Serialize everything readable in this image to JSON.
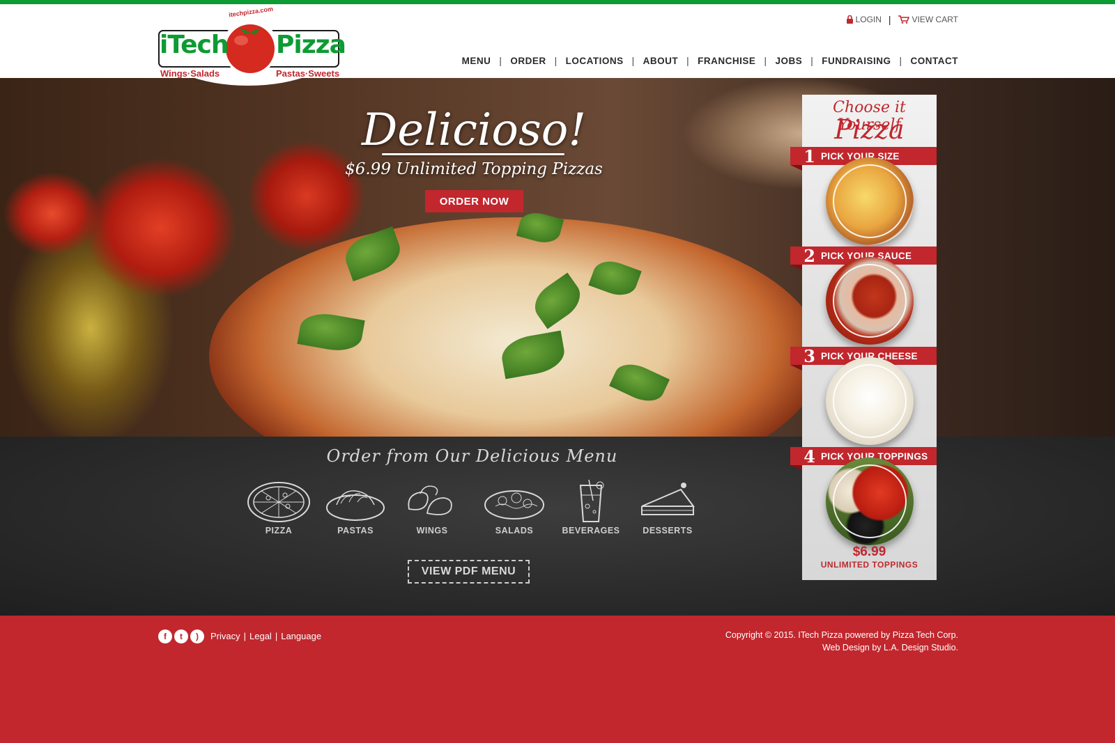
{
  "header": {
    "logo": {
      "brand_left": "iTech",
      "brand_right": "Pizza",
      "tag_left": "Wings·Salads",
      "tag_right": "Pastas·Sweets",
      "url": "itechpizza.com"
    },
    "util": {
      "login": "LOGIN",
      "separator": "|",
      "cart": "VIEW CART"
    },
    "nav": [
      "MENU",
      "ORDER",
      "LOCATIONS",
      "ABOUT",
      "FRANCHISE",
      "JOBS",
      "FUNDRAISING",
      "CONTACT"
    ],
    "nav_separator": "|"
  },
  "hero": {
    "title": "Delicioso!",
    "subtitle": "$6.99 Unlimited Topping Pizzas",
    "button": "ORDER NOW"
  },
  "builder": {
    "title_line1": "Choose it Yourself",
    "title_line2": "Pizza",
    "steps": [
      {
        "num": "1",
        "label": "PICK YOUR SIZE"
      },
      {
        "num": "2",
        "label": "PICK YOUR SAUCE"
      },
      {
        "num": "3",
        "label": "PICK YOUR CHEESE"
      },
      {
        "num": "4",
        "label": "PICK YOUR TOPPINGS"
      }
    ],
    "price": "$6.99",
    "price_label": "UNLIMITED TOPPINGS"
  },
  "menu": {
    "title": "Order from Our Delicious Menu",
    "items": [
      {
        "label": "PIZZA",
        "icon": "pizza-sketch-icon"
      },
      {
        "label": "PASTAS",
        "icon": "pasta-sketch-icon"
      },
      {
        "label": "WINGS",
        "icon": "wings-sketch-icon"
      },
      {
        "label": "SALADS",
        "icon": "salad-sketch-icon"
      },
      {
        "label": "BEVERAGES",
        "icon": "beverage-sketch-icon"
      },
      {
        "label": "DESSERTS",
        "icon": "dessert-sketch-icon"
      }
    ],
    "pdf_button": "VIEW PDF MENU"
  },
  "footer": {
    "social": [
      {
        "glyph": "f",
        "icon": "facebook-icon"
      },
      {
        "glyph": "t",
        "icon": "twitter-icon"
      },
      {
        "glyph": ")",
        "icon": "rss-icon"
      }
    ],
    "links": [
      "Privacy",
      "Legal",
      "Language"
    ],
    "separator": "|",
    "copyright": "Copyright © 2015. ITech Pizza powered by Pizza Tech Corp.",
    "credit": "Web Design by L.A. Design Studio."
  },
  "colors": {
    "brand_red": "#c1272d",
    "brand_green": "#0d9b33",
    "chalkboard": "#2a2a2a"
  }
}
